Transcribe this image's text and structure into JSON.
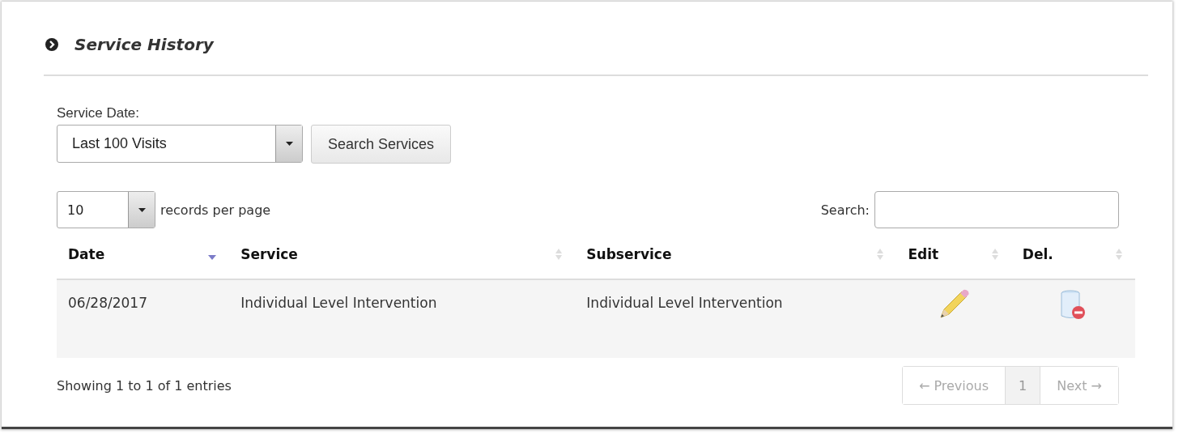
{
  "panel": {
    "title": "Service History",
    "expanded": false
  },
  "filter": {
    "label": "Service Date:",
    "value": "Last 100 Visits",
    "button": "Search Services"
  },
  "length": {
    "value": "10",
    "label": "records per page"
  },
  "search": {
    "label": "Search:"
  },
  "table": {
    "columns": [
      {
        "label": "Date",
        "sorted": true
      },
      {
        "label": "Service",
        "sorted": false
      },
      {
        "label": "Subservice",
        "sorted": false
      },
      {
        "label": "Edit",
        "sorted": false
      },
      {
        "label": "Del.",
        "sorted": false
      }
    ],
    "rows": [
      {
        "date": "06/28/2017",
        "service": "Individual Level Intervention",
        "subservice": "Individual Level Intervention"
      }
    ]
  },
  "info": "Showing 1 to 1 of 1 entries",
  "pagination": [
    {
      "label": "← Previous",
      "kind": "nav",
      "disabled": true,
      "selected": false
    },
    {
      "label": "1",
      "kind": "page",
      "disabled": false,
      "selected": true
    },
    {
      "label": "Next →",
      "kind": "nav",
      "disabled": true,
      "selected": false
    }
  ]
}
